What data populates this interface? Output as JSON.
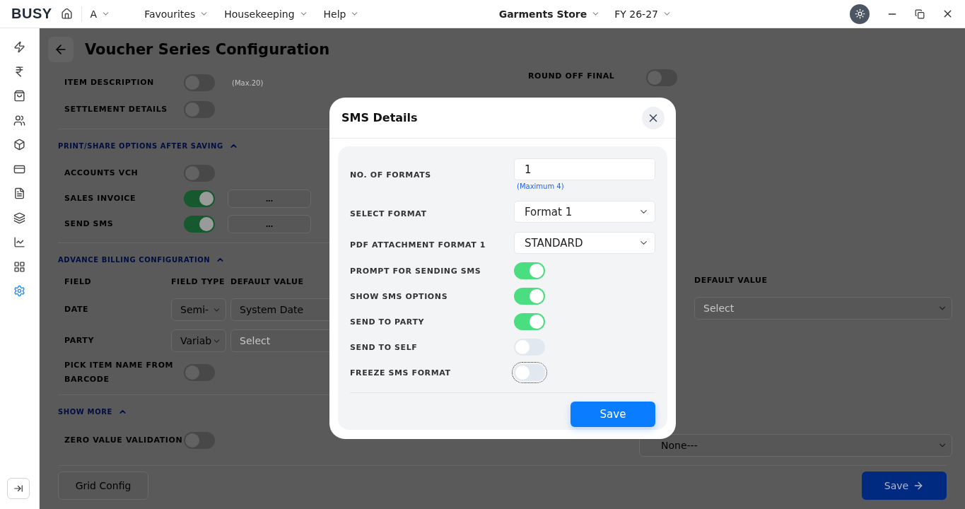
{
  "topbar": {
    "logo": "BUSY",
    "user": "A",
    "menus": [
      "Favourites",
      "Housekeeping",
      "Help"
    ],
    "company": "Garments Store",
    "year": "FY 26-27"
  },
  "sidebar": {
    "items": [
      {
        "selected": false
      },
      {
        "selected": false
      },
      {
        "selected": false
      },
      {
        "selected": false
      },
      {
        "selected": false
      },
      {
        "selected": false
      },
      {
        "selected": false
      },
      {
        "selected": false
      },
      {
        "selected": false
      },
      {
        "selected": false
      },
      {
        "selected": true
      }
    ]
  },
  "page": {
    "title": "Voucher Series Configuration",
    "top_rows": [
      {
        "label": "ITEM DESCRIPTION",
        "on": false,
        "note": "(Max.20)"
      },
      {
        "label": "SETTLEMENT DETAILS",
        "on": false
      }
    ],
    "print_section": {
      "title": "PRINT/SHARE OPTIONS AFTER SAVING",
      "expanded": true,
      "rows": [
        {
          "label": "ACCOUNTS VCH",
          "on": false
        },
        {
          "label": "SALES INVOICE",
          "on": true,
          "button": "..."
        },
        {
          "label": "SEND SMS",
          "on": true,
          "button": "..."
        }
      ]
    },
    "billing_section": {
      "title": "ADVANCE BILLING CONFIGURATION",
      "expanded": true,
      "columns": [
        "FIELD",
        "FIELD TYPE",
        "DEFAULT VALUE"
      ],
      "rows": [
        {
          "field": "DATE",
          "type": "Semi-",
          "value": "System Date"
        },
        {
          "field": "PARTY",
          "type": "Variab",
          "placeholder": "Select"
        }
      ],
      "barcode_row": {
        "label": "PICK ITEM NAME FROM BARCODE",
        "on": false
      }
    },
    "show_more": {
      "title": "SHOW MORE",
      "expanded": true,
      "rows": [
        {
          "label": "ZERO VALUE VALIDATION",
          "on": false
        }
      ]
    },
    "right": {
      "round_off": {
        "label": "ROUND OFF FINAL",
        "on": false
      },
      "column": "DEFAULT VALUE",
      "placeholder": "Select",
      "sorting_value": "None---"
    },
    "grid_button": "Grid Config",
    "save_button": "Save"
  },
  "modal": {
    "title": "SMS Details",
    "fields": [
      {
        "kind": "input",
        "label": "NO. OF FORMATS",
        "value": "1",
        "hint": "(Maximum 4)"
      },
      {
        "kind": "select",
        "label": "SELECT FORMAT",
        "value": "Format 1"
      },
      {
        "kind": "select",
        "label": "PDF ATTACHMENT FORMAT 1",
        "value": "STANDARD"
      },
      {
        "kind": "toggle",
        "label": "PROMPT FOR SENDING SMS",
        "on": true,
        "focused": false
      },
      {
        "kind": "toggle",
        "label": "SHOW SMS OPTIONS",
        "on": true,
        "focused": false
      },
      {
        "kind": "toggle",
        "label": "SEND TO PARTY",
        "on": true,
        "focused": false
      },
      {
        "kind": "toggle",
        "label": "SEND TO SELF",
        "on": false,
        "focused": false
      },
      {
        "kind": "toggle",
        "label": "FREEZE SMS FORMAT",
        "on": false,
        "focused": true
      }
    ],
    "save": "Save"
  }
}
